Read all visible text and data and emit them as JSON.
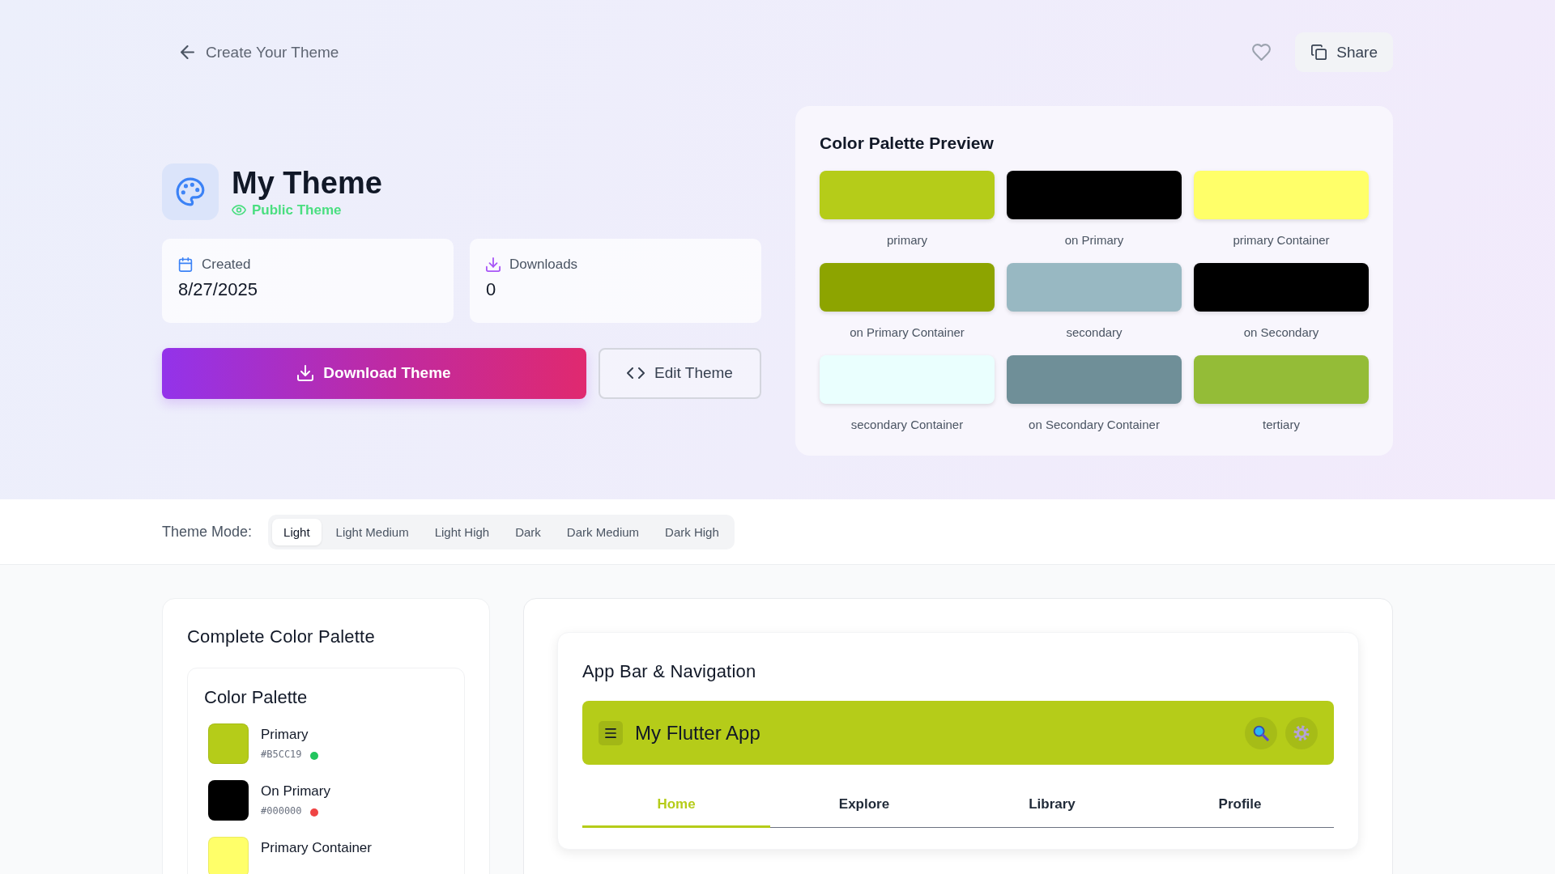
{
  "header": {
    "back_label": "Create Your Theme",
    "share_label": "Share"
  },
  "theme": {
    "name": "My Theme",
    "visibility": "Public Theme",
    "stats": [
      {
        "kind": "created",
        "label": "Created",
        "value": "8/27/2025"
      },
      {
        "kind": "downloads",
        "label": "Downloads",
        "value": "0"
      }
    ]
  },
  "actions": [
    {
      "kind": "download",
      "label": "Download Theme"
    },
    {
      "kind": "edit",
      "label": "Edit Theme"
    }
  ],
  "preview": {
    "title": "Color Palette Preview",
    "swatches": [
      {
        "name": "primary",
        "color": "#b5cc19"
      },
      {
        "name": "on Primary",
        "color": "#000000"
      },
      {
        "name": "primary Container",
        "color": "#ffff69"
      },
      {
        "name": "on Primary Container",
        "color": "#8da400"
      },
      {
        "name": "secondary",
        "color": "#98b8c2"
      },
      {
        "name": "on Secondary",
        "color": "#000000"
      },
      {
        "name": "secondary Container",
        "color": "#eafffe"
      },
      {
        "name": "on Secondary Container",
        "color": "#6f8f98"
      },
      {
        "name": "tertiary",
        "color": "#94bc37"
      }
    ]
  },
  "theme_mode": {
    "label": "Theme Mode:",
    "options": [
      {
        "label": "Light",
        "selected": true
      },
      {
        "label": "Light Medium",
        "selected": false
      },
      {
        "label": "Light High",
        "selected": false
      },
      {
        "label": "Dark",
        "selected": false
      },
      {
        "label": "Dark Medium",
        "selected": false
      },
      {
        "label": "Dark High",
        "selected": false
      }
    ]
  },
  "complete_palette": {
    "title": "Complete Color Palette",
    "card_title": "Color Palette",
    "colors": [
      {
        "name": "Primary",
        "hex": "#B5CC19",
        "color": "#b5cc19",
        "contrast": {
          "color": "#22c55e"
        }
      },
      {
        "name": "On Primary",
        "hex": "#000000",
        "color": "#000000",
        "contrast": {
          "color": "#ef4444"
        }
      },
      {
        "name": "Primary Container",
        "color": "#ffff69"
      }
    ]
  },
  "app_preview": {
    "title": "App Bar & Navigation",
    "app_title": "My Flutter App",
    "tabs": [
      {
        "label": "Home",
        "selected": true
      },
      {
        "label": "Explore",
        "selected": false
      },
      {
        "label": "Library",
        "selected": false
      },
      {
        "label": "Profile",
        "selected": false
      }
    ]
  }
}
